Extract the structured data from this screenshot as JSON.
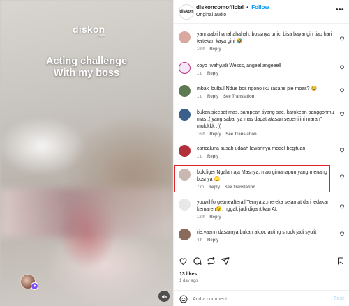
{
  "video": {
    "brand": "diskon",
    "brand_sub": ".com",
    "overlay_line1": "Acting challenge",
    "overlay_line2": "With my boss"
  },
  "header": {
    "username": "diskoncomofficial",
    "separator": "•",
    "follow_label": "Follow",
    "audio": "Original audio",
    "avatar_text": "diskon"
  },
  "comments": [
    {
      "user": "yannaabii",
      "text": "hahahahahah, bossnya unic. bisa bayangin tiap hari tertekan kaya gini 🤣",
      "time": "19 h",
      "likes": "",
      "reply": "Reply",
      "translate": "",
      "avatar_color": "#d9a8a0"
    },
    {
      "user": "coyo_wahyudi",
      "text": "Wesss, angeel angeeell",
      "time": "1 d",
      "likes": "",
      "reply": "Reply",
      "translate": "",
      "avatar_color": "#f3e7f7"
    },
    {
      "user": "mbak_bulbul",
      "text": "Ndue bos ngono iku rasane pie moas? 😂",
      "time": "1 d",
      "likes": "",
      "reply": "Reply",
      "translate": "See Translation",
      "avatar_color": "#5d7a52"
    },
    {
      "user": "bukan.sicepat",
      "text": "mas, sampean tiyang sae, karokean panggonmu mas :( yang sabar ya mas dapat atasan seperti ini marah\" mulukkk :((",
      "time": "16 h",
      "likes": "",
      "reply": "Reply",
      "translate": "See Translation",
      "avatar_color": "#3a5f8a"
    },
    {
      "user": "caricaluna",
      "text": "susah udaah lawannya model begituan",
      "time": "1 d",
      "likes": "",
      "reply": "Reply",
      "translate": "",
      "avatar_color": "#b2303a"
    },
    {
      "user": "bpk.liger",
      "text": "Ngalah aja Masnya, mau gimanapun yang menang bosnya 🙄",
      "time": "7 m",
      "likes": "",
      "reply": "Reply",
      "translate": "See Translation",
      "avatar_color": "#c9b8b0"
    },
    {
      "user": "youwillforgetmeafterall",
      "text": "Ternyata.mereka selamat dari ledakan kemaren😉, nggak jadi digantikan AI.",
      "time": "12 h",
      "likes": "",
      "reply": "Reply",
      "translate": "",
      "avatar_color": "#e8e8e8"
    },
    {
      "user": "rie.vaann",
      "text": "dasarnya bukan aktor, acting shock jadi syulit",
      "time": "4 h",
      "likes": "",
      "reply": "Reply",
      "translate": "",
      "avatar_color": "#8a6a5a"
    }
  ],
  "footer": {
    "likes": "13 likes",
    "ago": "1 day ago",
    "comment_placeholder": "Add a comment…",
    "post_label": "Post"
  },
  "colors": {
    "link_blue": "#0095f6",
    "highlight_red": "#e0242b",
    "text_secondary": "#737373"
  }
}
